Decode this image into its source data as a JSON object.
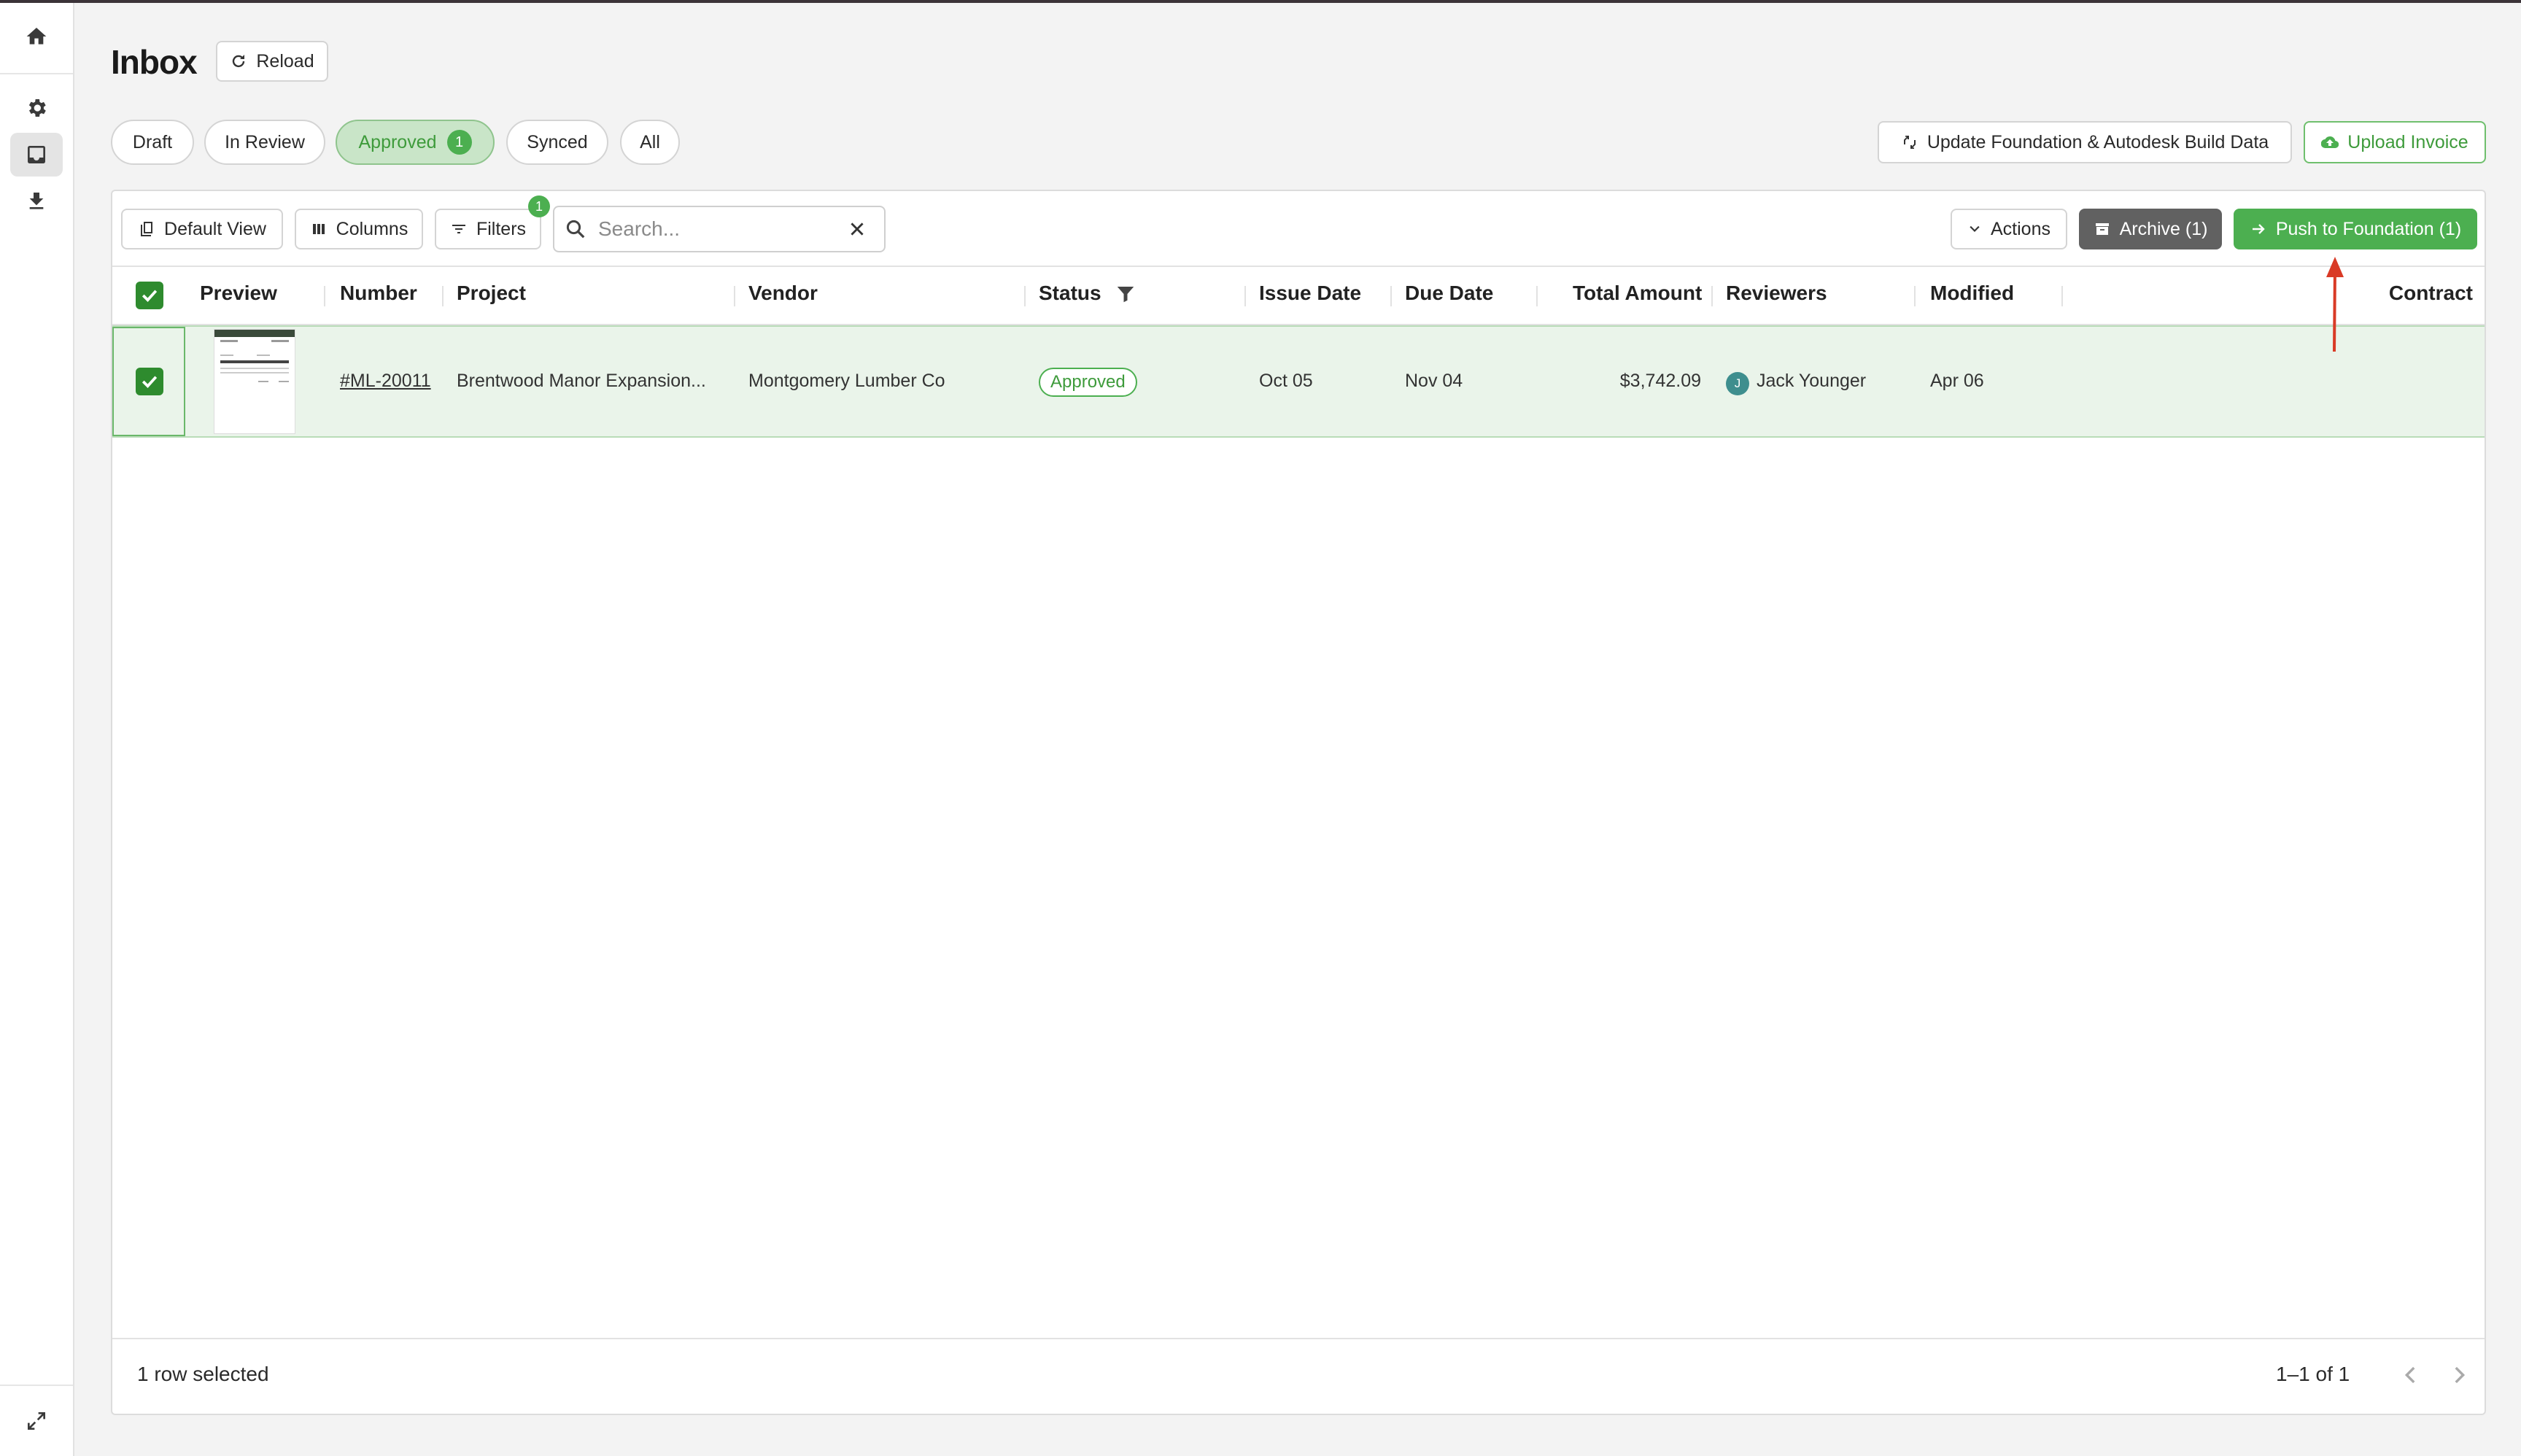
{
  "sidebar": {
    "items": [
      {
        "name": "home",
        "icon": "home-icon"
      },
      {
        "name": "settings",
        "icon": "gear-icon"
      },
      {
        "name": "inbox",
        "icon": "inbox-icon"
      },
      {
        "name": "download",
        "icon": "download-icon"
      }
    ],
    "expand_icon": "expand-icon"
  },
  "header": {
    "title": "Inbox",
    "reload_label": "Reload",
    "update_label": "Update Foundation & Autodesk Build Data",
    "upload_label": "Upload Invoice"
  },
  "status_tabs": [
    {
      "label": "Draft"
    },
    {
      "label": "In Review"
    },
    {
      "label": "Approved",
      "count": "1",
      "active": true
    },
    {
      "label": "Synced"
    },
    {
      "label": "All"
    }
  ],
  "toolbar": {
    "default_view_label": "Default View",
    "columns_label": "Columns",
    "filters_label": "Filters",
    "filters_count": "1",
    "search_placeholder": "Search...",
    "search_value": "",
    "actions_label": "Actions",
    "archive_label": "Archive (1)",
    "push_label": "Push to Foundation (1)"
  },
  "columns": [
    "Preview",
    "Number",
    "Project",
    "Vendor",
    "Status",
    "Issue Date",
    "Due Date",
    "Total Amount",
    "Reviewers",
    "Modified",
    "Contract"
  ],
  "rows": [
    {
      "selected": true,
      "number": "#ML-20011",
      "project": "Brentwood Manor Expansion...",
      "vendor": "Montgomery Lumber Co",
      "status": "Approved",
      "issue_date": "Oct 05",
      "due_date": "Nov 04",
      "total_amount": "$3,742.09",
      "reviewer_initial": "J",
      "reviewer": "Jack Younger",
      "modified": "Apr 06",
      "contract": ""
    }
  ],
  "footer": {
    "selection_text": "1 row selected",
    "pagination": "1–1 of 1"
  },
  "colors": {
    "accent_green": "#4caf50",
    "dark_green": "#2e8b2e",
    "archive_gray": "#616161",
    "annotation_red": "#d93a26",
    "link_blue": "#2a6bd6"
  }
}
